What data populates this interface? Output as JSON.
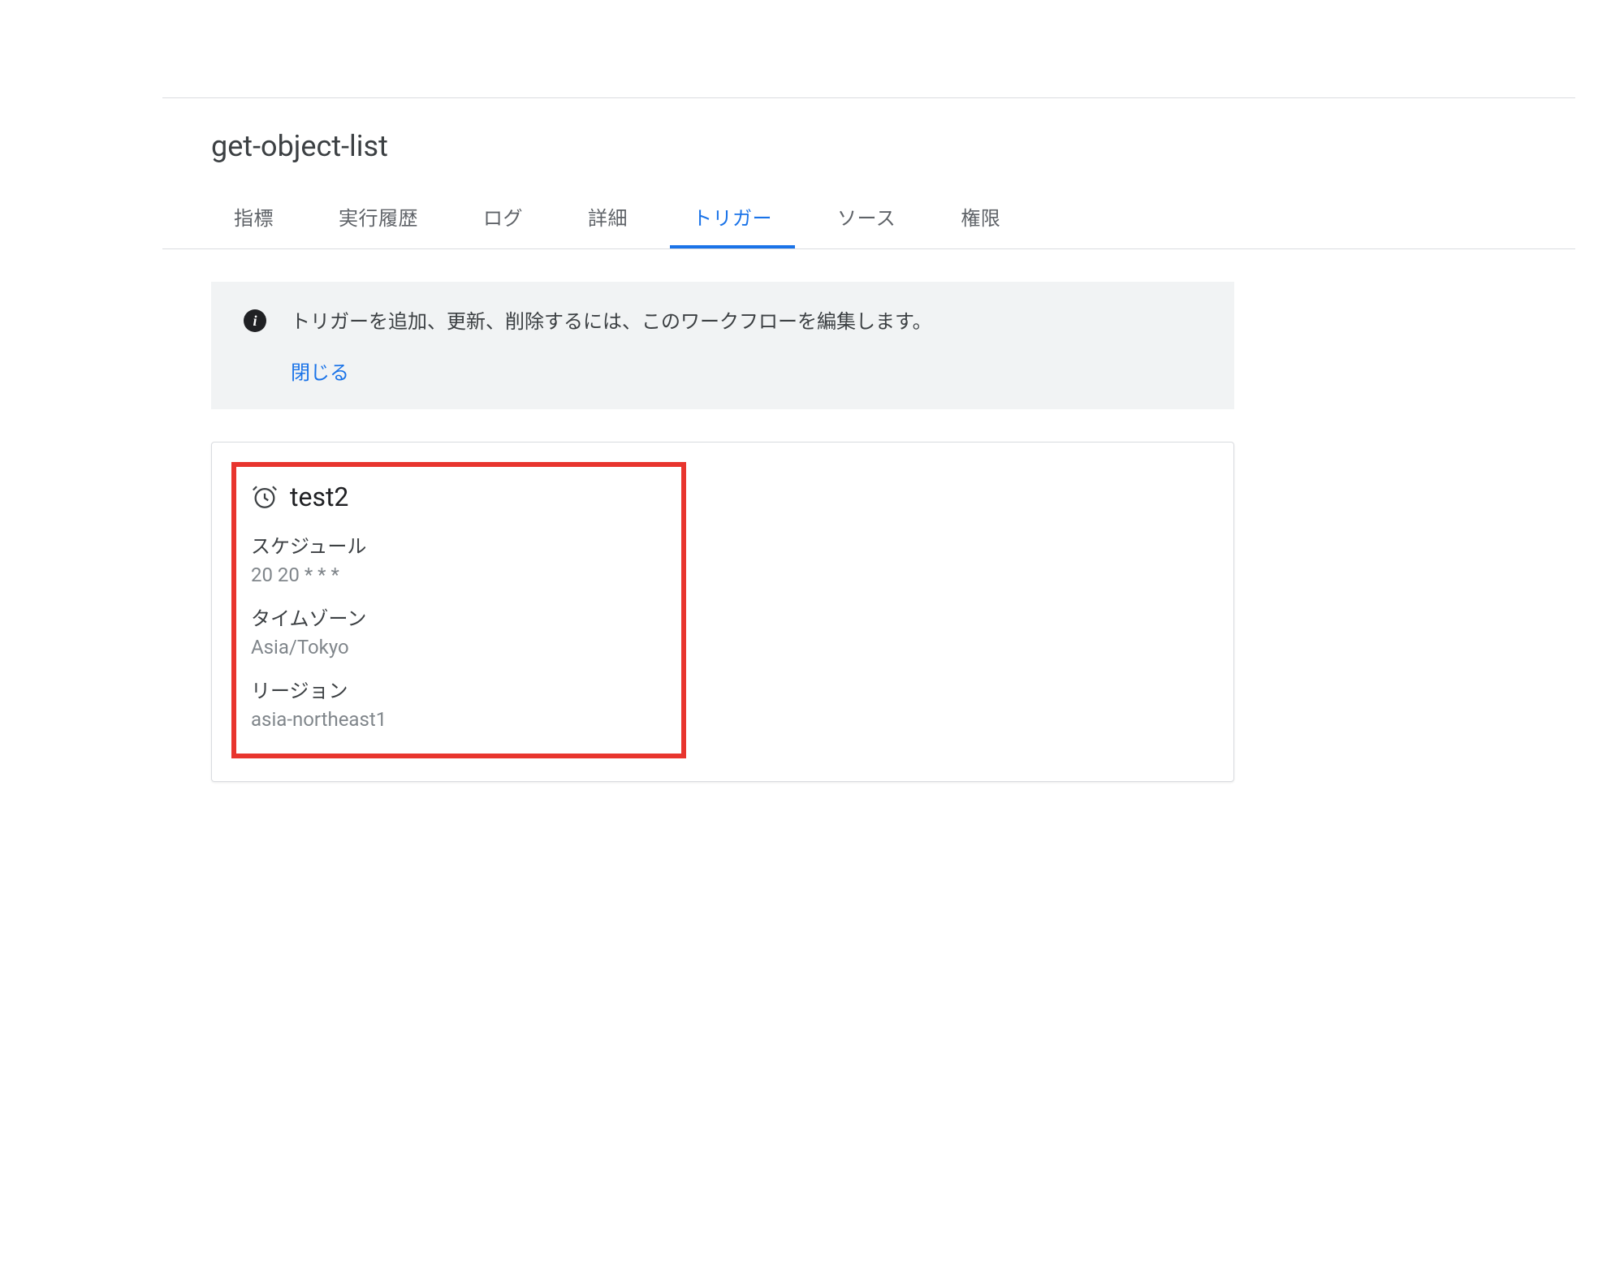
{
  "page": {
    "title": "get-object-list"
  },
  "tabs": [
    {
      "label": "指標",
      "active": false
    },
    {
      "label": "実行履歴",
      "active": false
    },
    {
      "label": "ログ",
      "active": false
    },
    {
      "label": "詳細",
      "active": false
    },
    {
      "label": "トリガー",
      "active": true
    },
    {
      "label": "ソース",
      "active": false
    },
    {
      "label": "権限",
      "active": false
    }
  ],
  "banner": {
    "text": "トリガーを追加、更新、削除するには、このワークフローを編集します。",
    "close_label": "閉じる"
  },
  "trigger": {
    "name": "test2",
    "schedule_label": "スケジュール",
    "schedule_value": "20 20 * * *",
    "timezone_label": "タイムゾーン",
    "timezone_value": "Asia/Tokyo",
    "region_label": "リージョン",
    "region_value": "asia-northeast1"
  }
}
